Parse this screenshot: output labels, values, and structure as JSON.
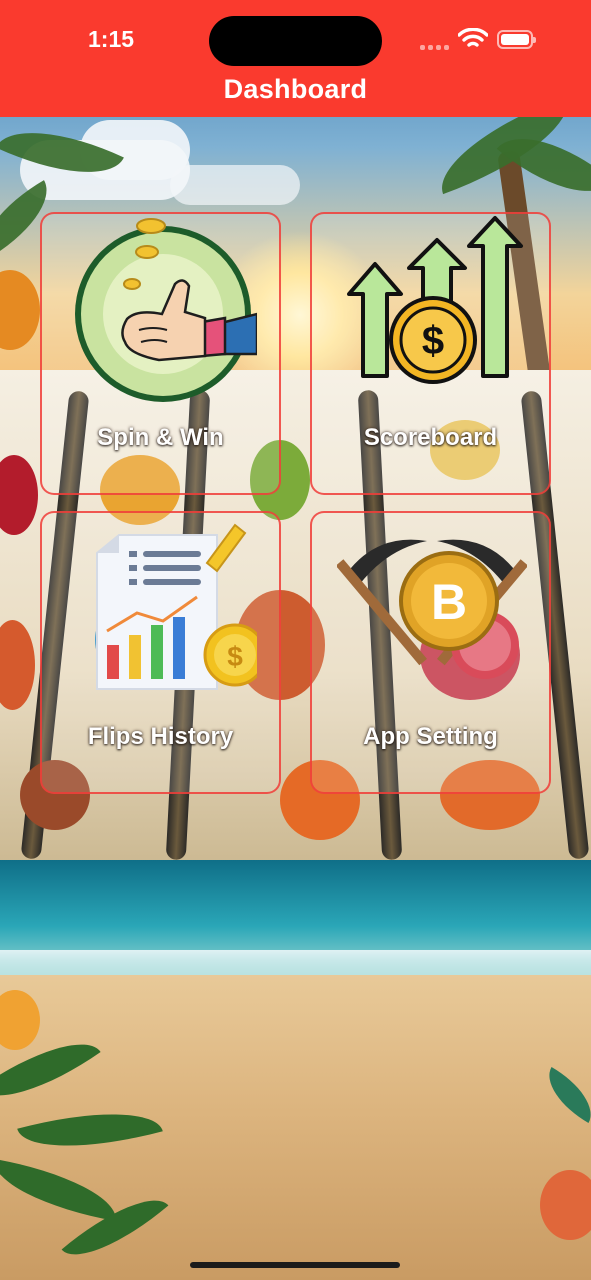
{
  "status_bar": {
    "time": "1:15"
  },
  "header": {
    "title": "Dashboard",
    "background_color": "#fa3a2e"
  },
  "cards": [
    {
      "label": "Spin & Win",
      "icon": "thumb-coin-flip-icon"
    },
    {
      "label": "Scoreboard",
      "icon": "dollar-growth-arrows-icon"
    },
    {
      "label": "Flips History",
      "icon": "report-chart-coin-icon"
    },
    {
      "label": "App Setting",
      "icon": "bitcoin-pickaxe-icon"
    }
  ],
  "colors": {
    "accent": "#fa3a2e",
    "card_border": "#f03c37"
  }
}
